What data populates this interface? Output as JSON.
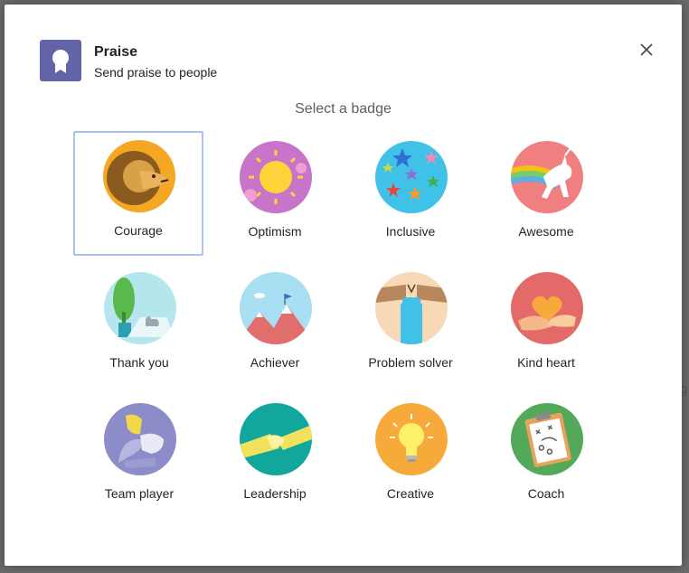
{
  "dialog": {
    "title": "Praise",
    "subtitle": "Send praise to people",
    "section_heading": "Select a badge",
    "app_icon": "ribbon-award-icon",
    "close_icon": "close-icon"
  },
  "background": {
    "partial_char": "g"
  },
  "badges": [
    {
      "label": "Courage",
      "selected": true,
      "icon": "lion-icon"
    },
    {
      "label": "Optimism",
      "selected": false,
      "icon": "sun-icon"
    },
    {
      "label": "Inclusive",
      "selected": false,
      "icon": "stars-icon"
    },
    {
      "label": "Awesome",
      "selected": false,
      "icon": "unicorn-icon"
    },
    {
      "label": "Thank you",
      "selected": false,
      "icon": "thumbs-up-icon"
    },
    {
      "label": "Achiever",
      "selected": false,
      "icon": "mountain-flag-icon"
    },
    {
      "label": "Problem solver",
      "selected": false,
      "icon": "fist-icon"
    },
    {
      "label": "Kind heart",
      "selected": false,
      "icon": "heart-hands-icon"
    },
    {
      "label": "Team player",
      "selected": false,
      "icon": "team-hands-icon"
    },
    {
      "label": "Leadership",
      "selected": false,
      "icon": "handshake-icon"
    },
    {
      "label": "Creative",
      "selected": false,
      "icon": "lightbulb-icon"
    },
    {
      "label": "Coach",
      "selected": false,
      "icon": "clipboard-icon"
    }
  ],
  "colors": {
    "accent": "#6264a7",
    "selected_border": "#a7c3ee",
    "overlay": "#6b6b6b"
  }
}
